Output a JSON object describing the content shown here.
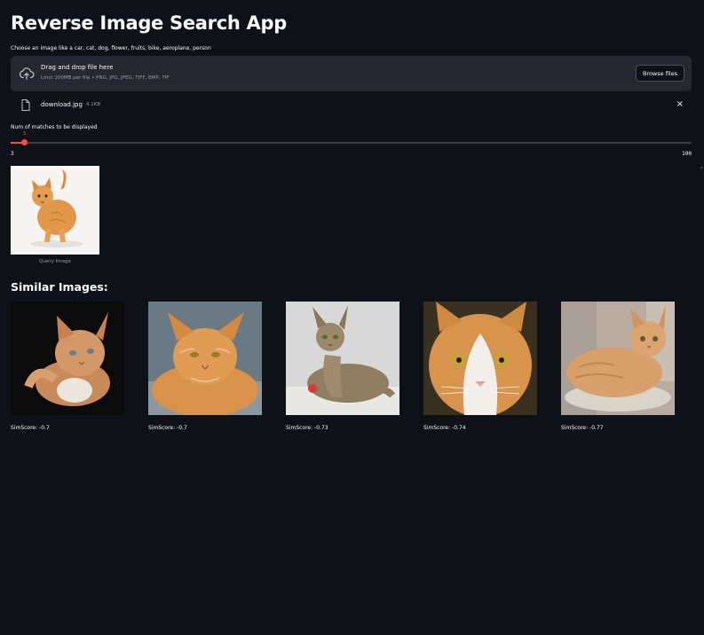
{
  "app": {
    "title": "Reverse Image Search App"
  },
  "uploader": {
    "label": "Choose an image like a car, cat, dog, flower, fruits, bike, aeroplane, person",
    "drop_text": "Drag and drop file here",
    "limit_text": "Limit 200MB per file • PNG, JPG, JPEG, TIFF, BMP, TIF",
    "browse_label": "Browse files",
    "file": {
      "name": "download.jpg",
      "size": "4.1KB",
      "remove_glyph": "×"
    }
  },
  "slider": {
    "label": "Num of matches to be displayed",
    "value": 5,
    "value_text": "5",
    "min": 3,
    "max": 100,
    "min_text": "3",
    "max_text": "100"
  },
  "query": {
    "caption": "Query Image"
  },
  "results": {
    "heading": "Similar Images:",
    "items": [
      {
        "score_text": "SimScore: -0.7"
      },
      {
        "score_text": "SimScore: -0.7"
      },
      {
        "score_text": "SimScore: -0.73"
      },
      {
        "score_text": "SimScore: -0.74"
      },
      {
        "score_text": "SimScore: -0.77"
      }
    ]
  },
  "colors": {
    "background": "#0e1117",
    "panel": "#262730",
    "accent": "#ff4b4b",
    "text": "#fafafa",
    "muted": "#9a9ca6"
  }
}
